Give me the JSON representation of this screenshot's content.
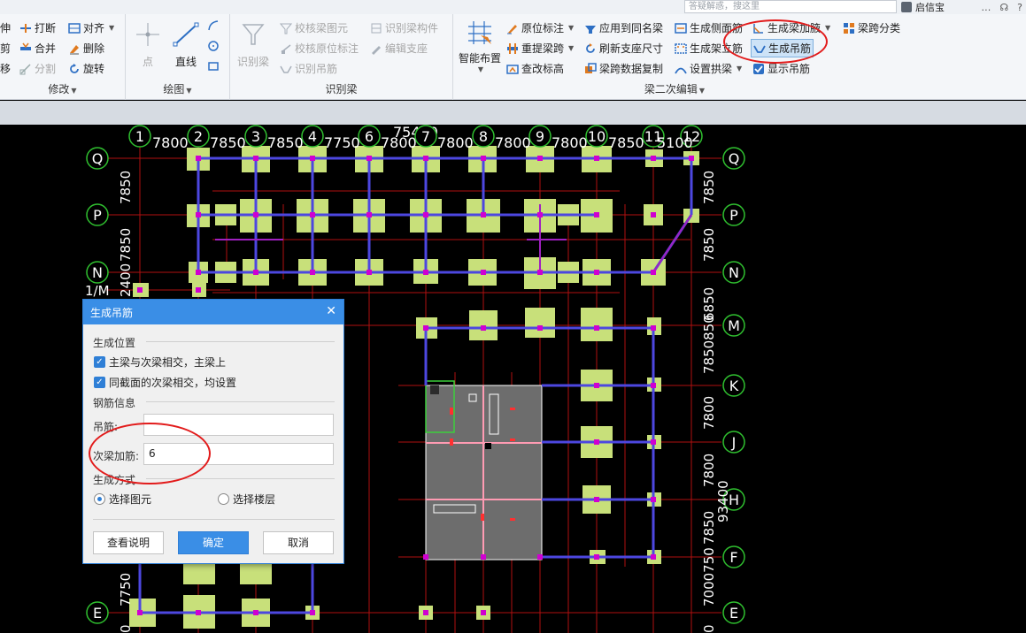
{
  "topbar": {
    "search_placeholder": "答疑解惑，搜这里",
    "user_name": "启信宝",
    "icons": [
      "message-icon",
      "headset-icon",
      "help-icon"
    ]
  },
  "ribbon": {
    "modify": {
      "title": "修改",
      "items": [
        "伸",
        "剪",
        "移",
        "打断",
        "合并",
        "分割",
        "对齐",
        "删除",
        "旋转"
      ]
    },
    "draw": {
      "title": "绘图",
      "point": "点",
      "line": "直线"
    },
    "identify": {
      "title": "识别梁",
      "big": "识别梁",
      "items": [
        "校核梁图元",
        "校核原位标注",
        "识别吊筋",
        "识别梁构件",
        "编辑支座"
      ]
    },
    "secondary": {
      "title": "梁二次编辑",
      "smart_layout": "智能布置",
      "col1": [
        "原位标注",
        "重提梁跨",
        "查改标高"
      ],
      "col2": [
        "应用到同名梁",
        "刷新支座尺寸",
        "梁跨数据复制"
      ],
      "col3": [
        "生成侧面筋",
        "生成架立筋",
        "设置拱梁"
      ],
      "col4": [
        "生成梁加腋",
        "生成吊筋",
        "显示吊筋"
      ],
      "col5": [
        "梁跨分类"
      ]
    }
  },
  "drawing": {
    "top_total": "75400",
    "axis_top": [
      "1",
      "2",
      "3",
      "4",
      "6",
      "7",
      "8",
      "9",
      "10",
      "11",
      "12"
    ],
    "spans_top": [
      "7800",
      "7850",
      "7850",
      "7750",
      "7800",
      "7800",
      "7800",
      "7800",
      "7850",
      "5100"
    ],
    "axis_side": [
      "Q",
      "P",
      "N",
      "M",
      "K",
      "J",
      "H",
      "F",
      "E"
    ],
    "left_extra_label": "1/M",
    "left_dims": [
      "7850",
      "7850",
      "2400",
      "7750",
      "0"
    ],
    "right_dims": [
      "7850",
      "7850",
      "6850",
      "7850850",
      "7800",
      "7800",
      "93400",
      "7850",
      "7000750",
      "0"
    ]
  },
  "dialog": {
    "title": "生成吊筋",
    "section_position": "生成位置",
    "check1": "主梁与次梁相交，主梁上",
    "check2": "同截面的次梁相交，均设置",
    "section_rebar": "钢筋信息",
    "label_hanger": "吊筋:",
    "value_hanger": "",
    "label_extra": "次梁加筋:",
    "value_extra": "6",
    "section_mode": "生成方式",
    "radio1": "选择图元",
    "radio2": "选择楼层",
    "btn_help": "查看说明",
    "btn_ok": "确定",
    "btn_cancel": "取消"
  }
}
